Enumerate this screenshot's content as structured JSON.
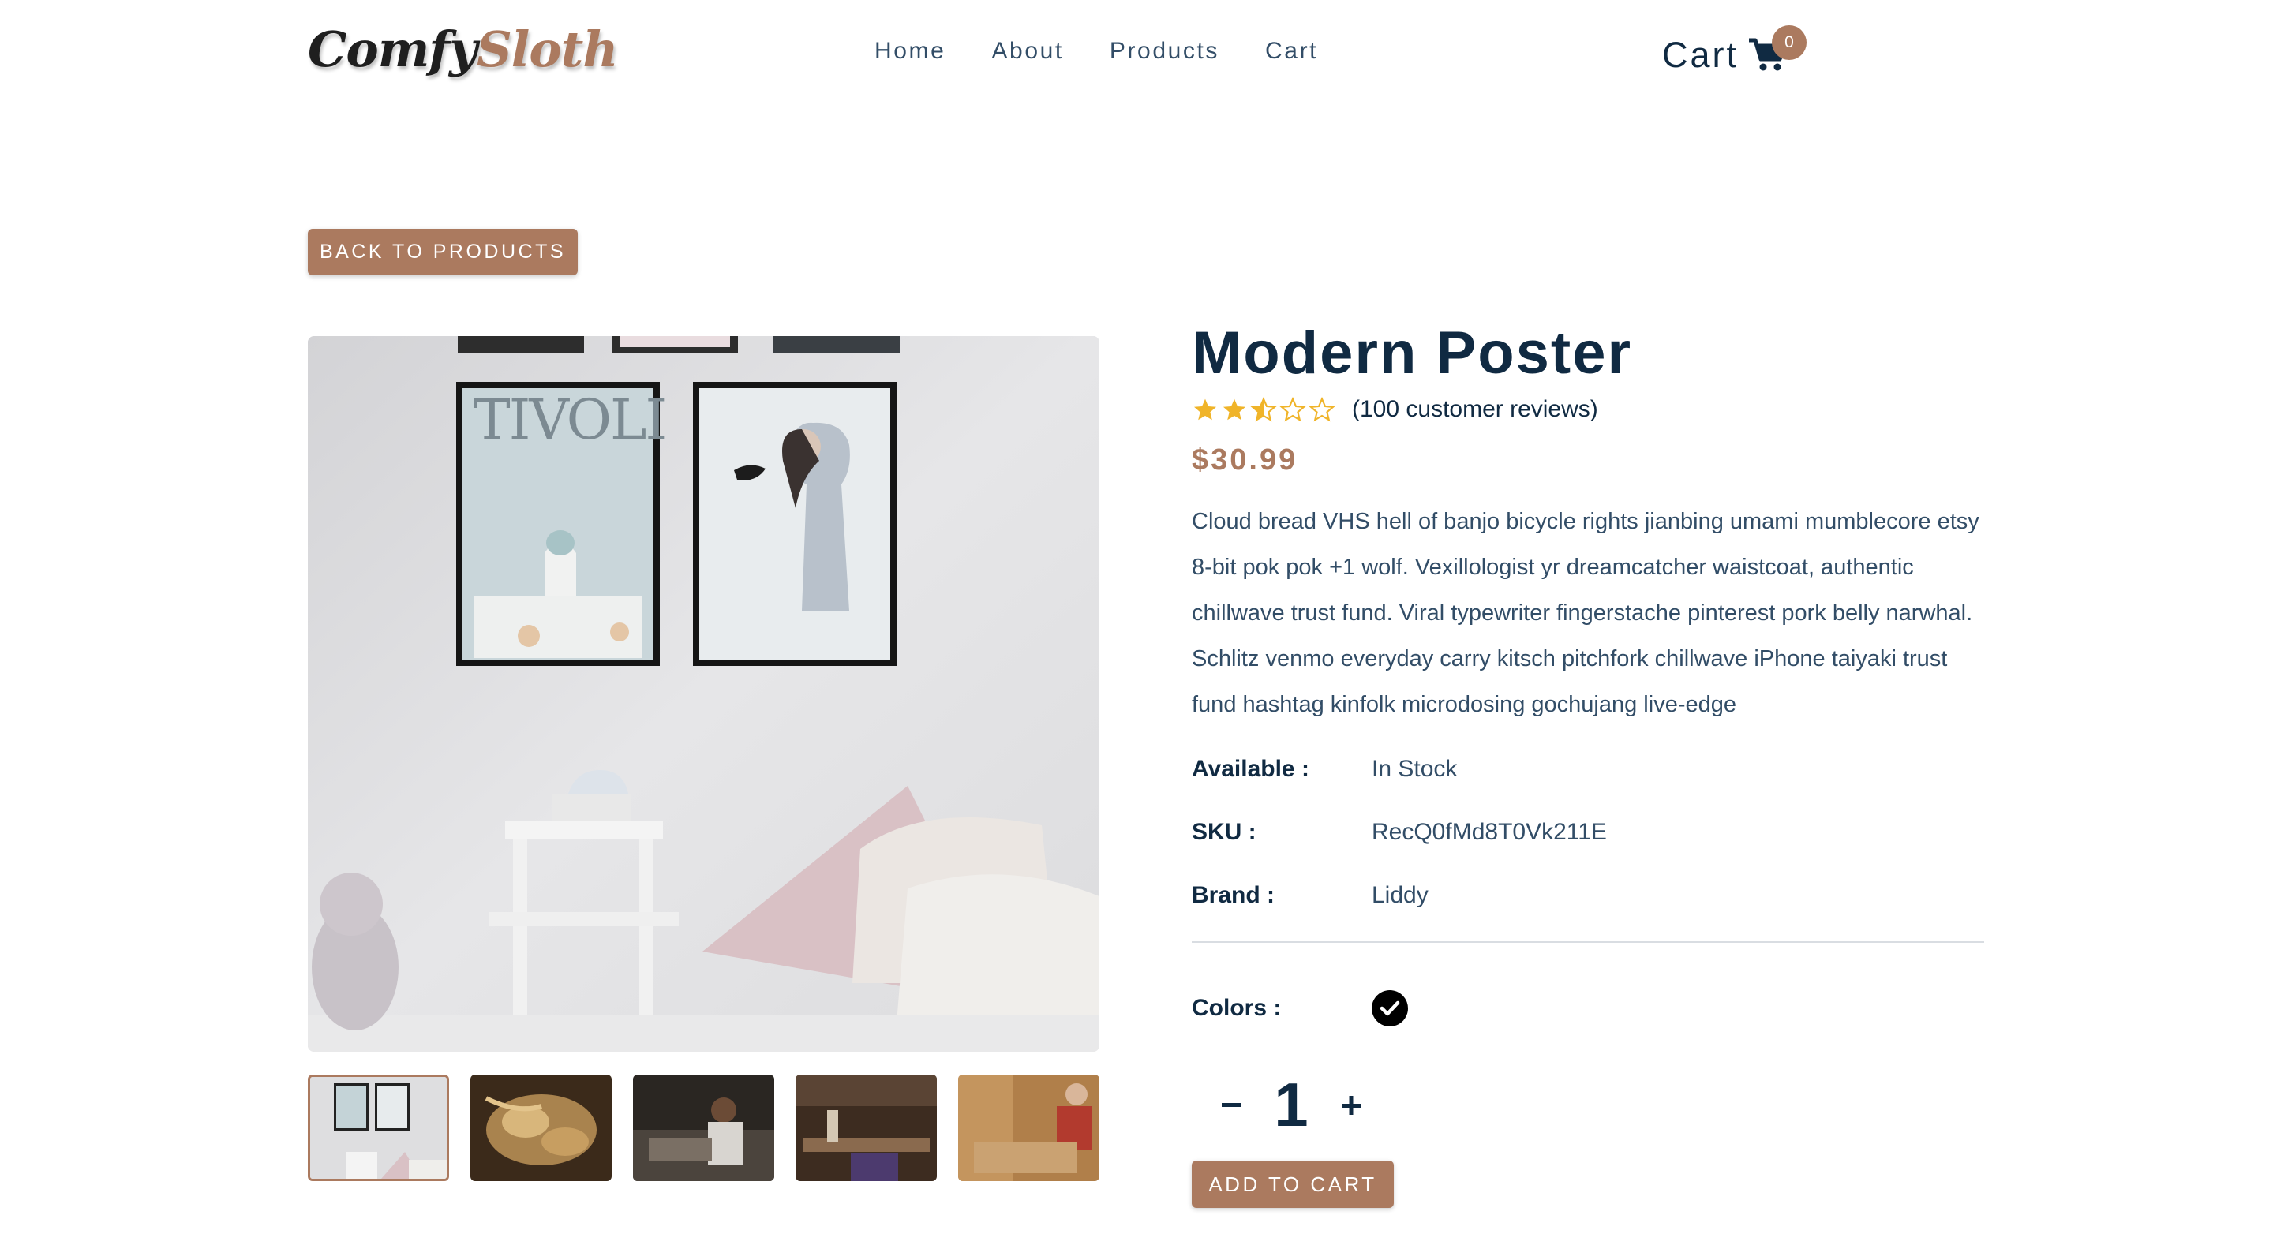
{
  "brand": {
    "part1": "Comfy",
    "part2": "Sloth"
  },
  "nav": {
    "links": [
      "Home",
      "About",
      "Products",
      "Cart"
    ]
  },
  "cart": {
    "label": "Cart",
    "count": "0"
  },
  "back_button": "Back to products",
  "product": {
    "title": "Modern Poster",
    "rating": 2.5,
    "reviews_text": "(100 customer reviews)",
    "price": "$30.99",
    "description": "Cloud bread VHS hell of banjo bicycle rights jianbing umami mumblecore etsy 8-bit pok pok +1 wolf. Vexillologist yr dreamcatcher waistcoat, authentic chillwave trust fund. Viral typewriter fingerstache pinterest pork belly narwhal. Schlitz venmo everyday carry kitsch pitchfork chillwave iPhone taiyaki trust fund hashtag kinfolk microdosing gochujang live-edge",
    "available_label": "Available :",
    "available_value": "In Stock",
    "sku_label": "SKU :",
    "sku_value": "RecQ0fMd8T0Vk211E",
    "brand_label": "Brand :",
    "brand_value": "Liddy",
    "colors_label": "Colors :",
    "colors": [
      "#000000"
    ],
    "quantity": "1",
    "add_to_cart": "Add to cart"
  },
  "colors": {
    "accent": "#ab7a5f",
    "text_dark": "#102a42",
    "text_body": "#324d67",
    "star": "#f0b429"
  },
  "thumbnails": [
    "poster-room",
    "wood-shavings",
    "woodworker",
    "workshop",
    "carpenter"
  ]
}
